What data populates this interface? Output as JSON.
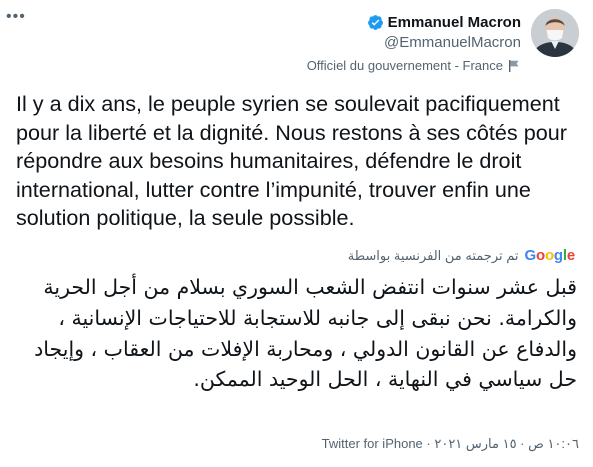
{
  "author": {
    "name": "Emmanuel Macron",
    "handle": "@EmmanuelMacron",
    "label": "Officiel du gouvernement - France",
    "verified_icon": "verified-badge-icon",
    "flag_icon": "government-flag-icon"
  },
  "menu_icon": "more-options-icon",
  "tweet": {
    "text_fr": "Il y a dix ans, le peuple syrien se soulevait pacifiquement pour la liberté et la dignité. Nous restons à ses côtés pour répondre aux besoins humanitaires, défendre le droit international, lutter contre l’impunité, trouver enfin une solution politique, la seule possible.",
    "translated_by": "تم ترجمته من الفرنسية بواسطة",
    "translator": {
      "g1": "G",
      "o1": "o",
      "o2": "o",
      "g2": "g",
      "l": "l",
      "e": "e"
    },
    "text_ar": "قبل عشر سنوات انتفض الشعب السوري بسلام من أجل الحرية والكرامة. نحن نبقى إلى جانبه للاستجابة للاحتياجات الإنسانية ، والدفاع عن القانون الدولي ، ومحاربة الإفلات من العقاب ، وإيجاد حل سياسي في النهاية ، الحل الوحيد الممكن.",
    "timestamp": "١٠:٠٦ ص · ١٥ مارس ٢٠٢١",
    "source": "Twitter for iPhone"
  },
  "colors": {
    "text": "#0f1419",
    "secondary": "#536471",
    "verified": "#1d9bf0"
  }
}
